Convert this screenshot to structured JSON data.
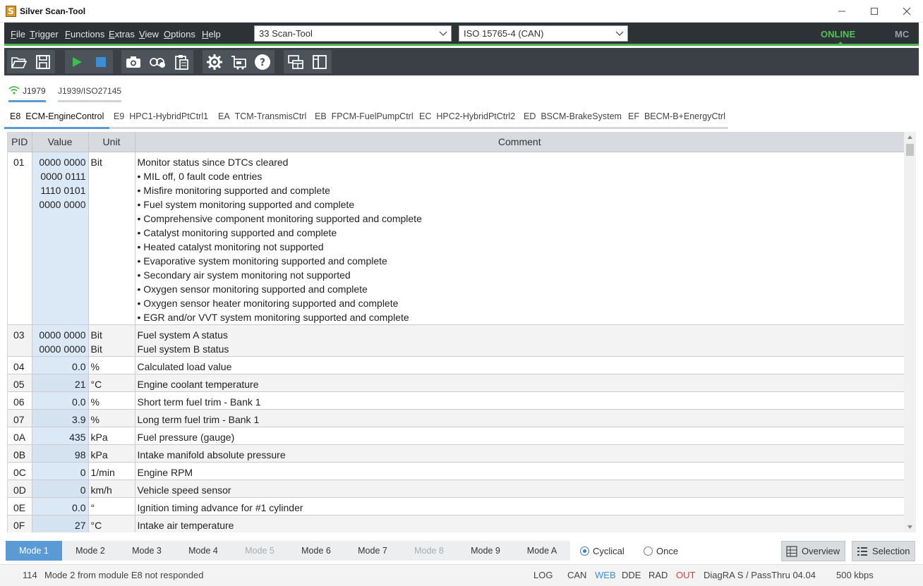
{
  "window": {
    "title": "Silver Scan-Tool",
    "app_icon": "S"
  },
  "menu": [
    {
      "key": "F",
      "rest": "ile"
    },
    {
      "key": "T",
      "rest": "rigger"
    },
    {
      "key": "F",
      "rest": "unctions"
    },
    {
      "key": "E",
      "rest": "xtras"
    },
    {
      "key": "V",
      "rest": "iew"
    },
    {
      "key": "O",
      "rest": "ptions"
    },
    {
      "key": "H",
      "rest": "elp"
    }
  ],
  "device_combo": {
    "value": "33  Scan-Tool"
  },
  "protocol_combo": {
    "value": "ISO 15765-4 (CAN)"
  },
  "connection": {
    "online": "ONLINE",
    "mc": "MC",
    "online_color": "#55c255"
  },
  "protocol_tabs": [
    "J1979",
    "J1939/ISO27145"
  ],
  "ecu_tabs": [
    {
      "id": "E8",
      "name": "ECM-EngineControl"
    },
    {
      "id": "E9",
      "name": "HPC1-HybridPtCtrl1"
    },
    {
      "id": "EA",
      "name": "TCM-TransmisCtrl"
    },
    {
      "id": "EB",
      "name": "FPCM-FuelPumpCtrl"
    },
    {
      "id": "EC",
      "name": "HPC2-HybridPtCtrl2"
    },
    {
      "id": "ED",
      "name": "BSCM-BrakeSystem"
    },
    {
      "id": "EF",
      "name": "BECM-B+EnergyCtrl"
    }
  ],
  "table": {
    "headers": [
      "PID",
      "Value",
      "Unit",
      "Comment"
    ],
    "rows": [
      {
        "pid": "01",
        "value": "0000 0000\n0000 0111\n1110 0101\n0000 0000",
        "unit": "Bit",
        "comment": "Monitor status since DTCs cleared\n• MIL off, 0 fault code entries\n• Misfire monitoring supported and complete\n• Fuel system monitoring supported and complete\n• Comprehensive component monitoring supported and complete\n• Catalyst monitoring supported and complete\n• Heated catalyst monitoring not supported\n• Evaporative system monitoring supported and complete\n• Secondary air system monitoring not supported\n• Oxygen sensor monitoring supported and complete\n• Oxygen sensor heater monitoring supported and complete\n• EGR and/or VVT system monitoring supported and complete"
      },
      {
        "pid": "03",
        "value": "0000 0000\n0000 0000",
        "unit": "Bit\nBit",
        "comment": "Fuel system A status\nFuel system B status"
      },
      {
        "pid": "04",
        "value": "0.0",
        "unit": "%",
        "comment": "Calculated load value"
      },
      {
        "pid": "05",
        "value": "21",
        "unit": "°C",
        "comment": "Engine coolant temperature"
      },
      {
        "pid": "06",
        "value": "0.0",
        "unit": "%",
        "comment": "Short term fuel trim - Bank 1"
      },
      {
        "pid": "07",
        "value": "3.9",
        "unit": "%",
        "comment": "Long term fuel trim - Bank 1"
      },
      {
        "pid": "0A",
        "value": "435",
        "unit": "kPa",
        "comment": "Fuel pressure (gauge)"
      },
      {
        "pid": "0B",
        "value": "98",
        "unit": "kPa",
        "comment": "Intake manifold absolute pressure"
      },
      {
        "pid": "0C",
        "value": "0",
        "unit": "1/min",
        "comment": "Engine RPM"
      },
      {
        "pid": "0D",
        "value": "0",
        "unit": "km/h",
        "comment": "Vehicle speed sensor"
      },
      {
        "pid": "0E",
        "value": "0.0",
        "unit": "°",
        "comment": "Ignition timing advance for #1 cylinder"
      },
      {
        "pid": "0F",
        "value": "27",
        "unit": "°C",
        "comment": "Intake air temperature"
      }
    ]
  },
  "modes": [
    {
      "label": "Mode 1",
      "state": "active"
    },
    {
      "label": "Mode 2",
      "state": "enabled"
    },
    {
      "label": "Mode 3",
      "state": "enabled"
    },
    {
      "label": "Mode 4",
      "state": "enabled"
    },
    {
      "label": "Mode 5",
      "state": "disabled"
    },
    {
      "label": "Mode 6",
      "state": "enabled"
    },
    {
      "label": "Mode 7",
      "state": "enabled"
    },
    {
      "label": "Mode 8",
      "state": "disabled"
    },
    {
      "label": "Mode 9",
      "state": "enabled"
    },
    {
      "label": "Mode A",
      "state": "enabled"
    }
  ],
  "trigger": {
    "cyclical": "Cyclical",
    "once": "Once",
    "selected": "cyclical"
  },
  "views": {
    "overview": "Overview",
    "selection": "Selection"
  },
  "status": {
    "code": "114",
    "message": "Mode 2 from module E8 not responded",
    "log": "LOG",
    "can": "CAN",
    "web": "WEB",
    "dde": "DDE",
    "rad": "RAD",
    "out": "OUT",
    "interface": "DiagRA S / PassThru 04.04",
    "baud": "500 kbps",
    "web_color": "#3b8fd6",
    "out_color": "#d63b3b"
  }
}
